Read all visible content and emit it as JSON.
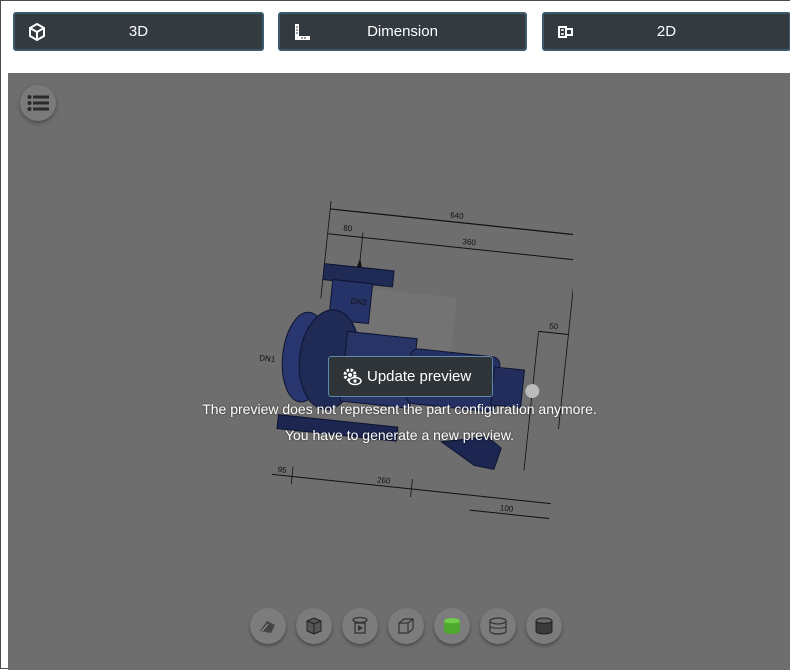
{
  "tabs": [
    {
      "label": "3D",
      "icon": "cube-icon"
    },
    {
      "label": "Dimension",
      "icon": "ruler-corner-icon"
    },
    {
      "label": "2D",
      "icon": "flat-part-icon"
    }
  ],
  "viewer": {
    "menu_icon": "list-icon",
    "update_button_label": "Update preview",
    "update_button_icon": "gear-eye-icon",
    "message_line1": "The preview does not represent the part configuration anymore.",
    "message_line2": "You have to generate a new preview.",
    "drawing": {
      "dimensions": [
        "640",
        "80",
        "360",
        "DN2",
        "50",
        "DN1",
        "95",
        "260",
        "100"
      ]
    },
    "view_buttons": [
      {
        "icon": "perspective-view-icon"
      },
      {
        "icon": "shaded-view-icon"
      },
      {
        "icon": "animation-view-icon"
      },
      {
        "icon": "wireframe-view-icon"
      },
      {
        "icon": "colored-shaded-view-icon"
      },
      {
        "icon": "hidden-line-view-icon"
      },
      {
        "icon": "solid-view-icon"
      }
    ]
  },
  "colors": {
    "tab_bg": "#333a40",
    "tab_border": "#3c5a6c",
    "viewer_bg": "#6e6e6e",
    "part_color": "#1f2a55",
    "active_view_green": "#4fa830"
  }
}
